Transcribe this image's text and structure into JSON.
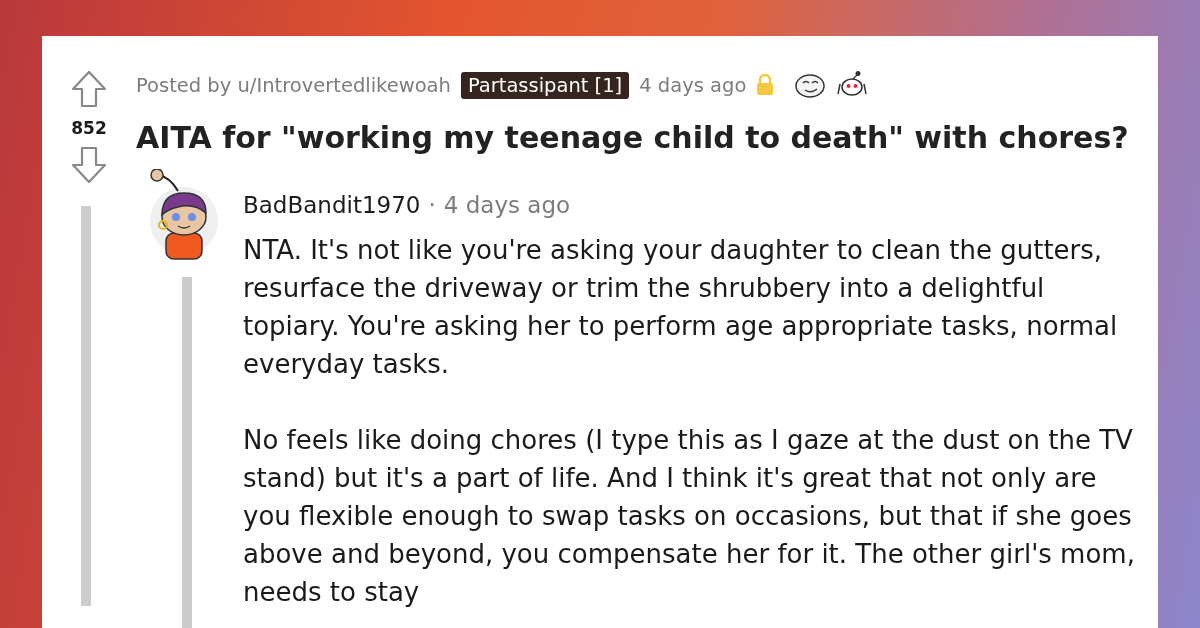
{
  "post": {
    "votes": "852",
    "posted_by": "Posted by u/Introvertedlikewoah",
    "flair": "Partassipant [1]",
    "time": "4 days ago",
    "locked": true,
    "title": "AITA for \"working my teenage child to death\" with chores?"
  },
  "comment": {
    "author": "BadBandit1970",
    "separator": "·",
    "time": "4 days ago",
    "paragraphs": [
      "NTA. It's not like you're asking your daughter to clean the gutters, resurface the driveway or trim the shrubbery into a delightful topiary. You're asking her to perform age appropriate tasks, normal everyday tasks.",
      "No feels like doing chores (I type this as I gaze at the dust on the TV stand) but it's a part of life. And I think it's great that not only are you flexible enough to swap tasks on occasions, but that if she goes above and beyond, you compensate her for it. The other girl's mom, needs to stay"
    ]
  }
}
